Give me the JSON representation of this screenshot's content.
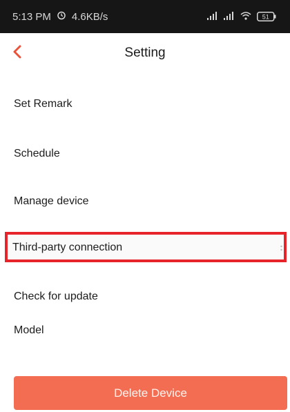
{
  "status_bar": {
    "time": "5:13 PM",
    "speed": "4.6KB/s",
    "battery": "51",
    "icons": [
      "alarm-icon",
      "signal-icon",
      "signal-icon",
      "wifi-icon",
      "battery-icon"
    ]
  },
  "header": {
    "title": "Setting",
    "back_icon": "chevron-left-icon",
    "accent_color": "#e8533a"
  },
  "menu": {
    "set_remark": "Set Remark",
    "schedule": "Schedule",
    "manage_device": "Manage device",
    "third_party": "Third-party connection",
    "check_update": "Check for update",
    "model": "Model"
  },
  "highlight_color": "#e8242b",
  "delete_button": {
    "label": "Delete Device",
    "color": "#f26d52"
  }
}
